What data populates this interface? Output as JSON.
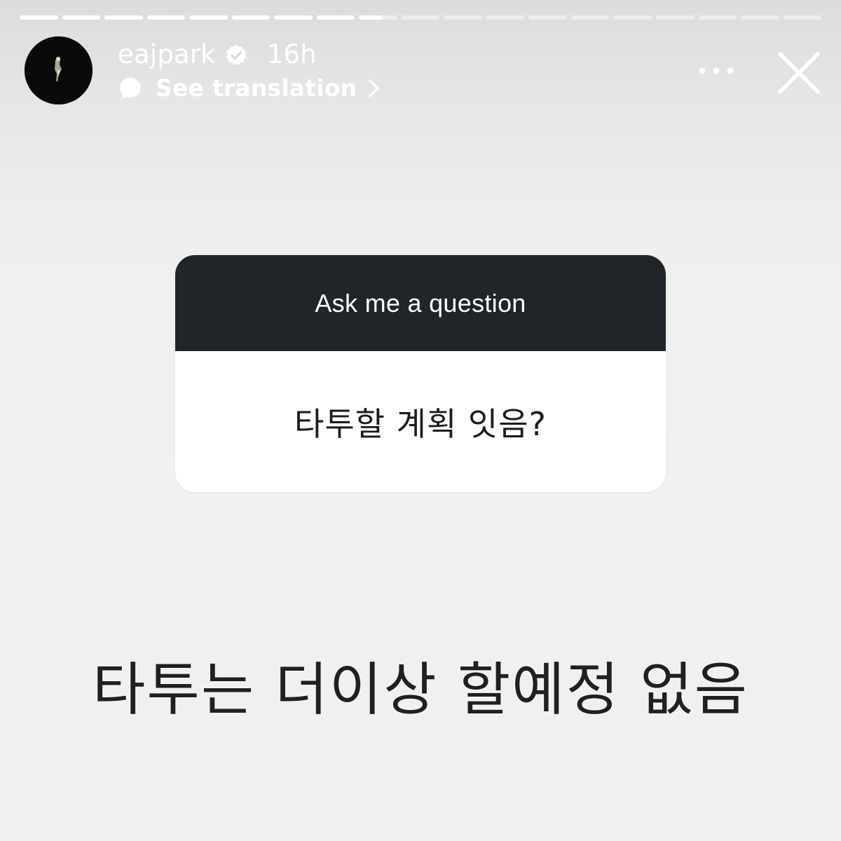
{
  "story": {
    "progress_segments": [
      1,
      1,
      1,
      1,
      1,
      1,
      1,
      1,
      0.6,
      0,
      0,
      0,
      0,
      0,
      0,
      0,
      0,
      0,
      0
    ]
  },
  "header": {
    "username": "eajpark",
    "timestamp": "16h",
    "translation_label": "See translation",
    "icons": [
      "verified-badge-icon",
      "speech-bubble-icon",
      "chevron-right-icon",
      "more-options-icon",
      "close-icon"
    ]
  },
  "question_sticker": {
    "title": "Ask me a question",
    "question": "타투할 계획 잇음?"
  },
  "answer": {
    "text": "타투는 더이상 할예정 없음"
  },
  "colors": {
    "sticker_header": "#212429",
    "sticker_body": "#ffffff",
    "background": "#f0f0f0",
    "answer_text": "#202020"
  }
}
